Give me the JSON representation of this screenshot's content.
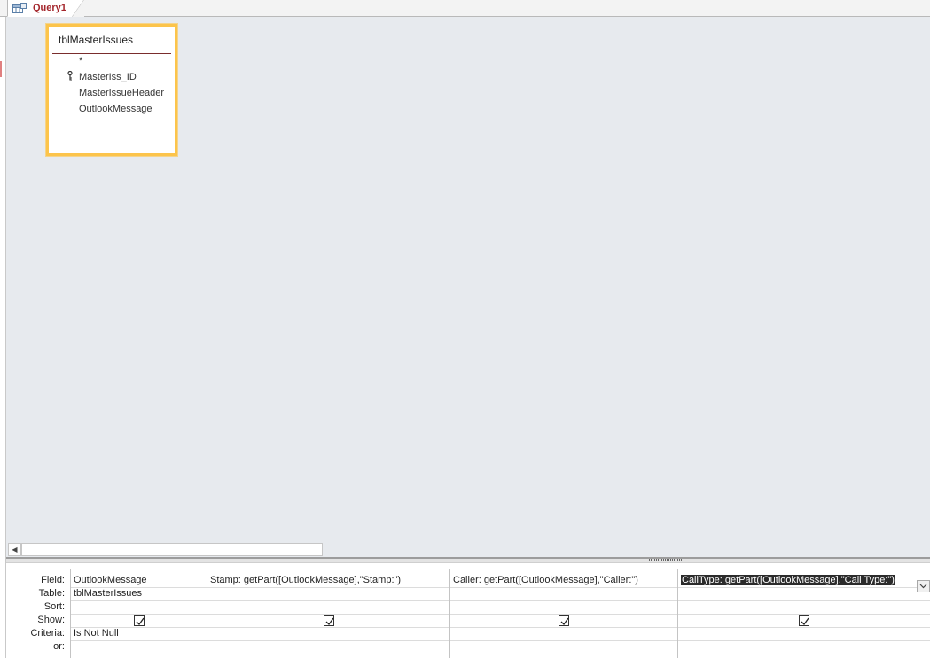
{
  "tab": {
    "label": "Query1",
    "icon": "query-design-icon"
  },
  "table_box": {
    "title": "tblMasterIssues",
    "fields": [
      "*",
      "MasterIss_ID",
      "MasterIssueHeader",
      "OutlookMessage"
    ],
    "primary_key_icon": "key-icon"
  },
  "grid": {
    "row_labels": {
      "field": "Field:",
      "table": "Table:",
      "sort": "Sort:",
      "show": "Show:",
      "criteria": "Criteria:",
      "or": "or:"
    },
    "columns": [
      {
        "field": "OutlookMessage",
        "table": "tblMasterIssues",
        "sort": "",
        "show": true,
        "criteria": "Is Not Null",
        "or": ""
      },
      {
        "field": "Stamp: getPart([OutlookMessage],\"Stamp:\")",
        "table": "",
        "sort": "",
        "show": true,
        "criteria": "",
        "or": ""
      },
      {
        "field": "Caller: getPart([OutlookMessage],\"Caller:\")",
        "table": "",
        "sort": "",
        "show": true,
        "criteria": "",
        "or": ""
      },
      {
        "field": "CallType: getPart([OutlookMessage],\"Call Type:\")",
        "table": "",
        "sort": "",
        "show": true,
        "criteria": "",
        "or": "",
        "selected": true
      }
    ]
  },
  "colors": {
    "tab_text": "#a4262c",
    "table_box_border": "#fcc44b",
    "design_background": "#e7eaee",
    "selection": "#2b2b2b"
  }
}
